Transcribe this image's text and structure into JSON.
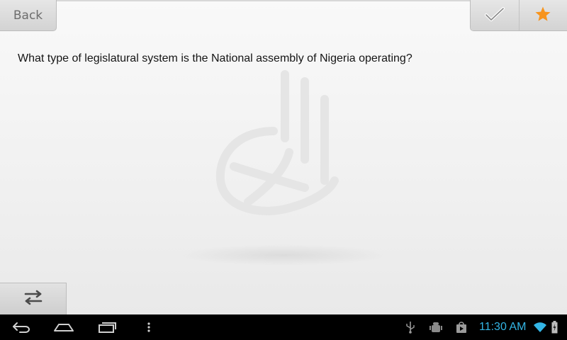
{
  "header": {
    "back_label": "Back",
    "actions": [
      {
        "name": "checkmark-icon"
      },
      {
        "name": "star-icon",
        "color": "#f7941d"
      }
    ]
  },
  "question": {
    "text": "What type of legislatural system is the National assembly of Nigeria operating?"
  },
  "bottom_bar": {
    "menu_icon": "swap-arrows-icon"
  },
  "system_bar": {
    "nav_buttons": [
      "back-icon",
      "home-icon",
      "recent-apps-icon",
      "overflow-menu-icon"
    ],
    "status_icons": [
      "usb-icon",
      "android-debug-icon",
      "store-icon",
      "wifi-icon",
      "battery-icon"
    ],
    "time": "11:30 AM",
    "accent_color": "#33b5e5"
  }
}
